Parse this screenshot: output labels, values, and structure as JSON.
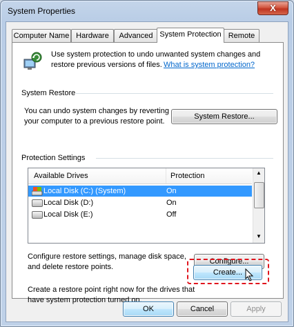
{
  "window": {
    "title": "System Properties",
    "close_glyph": "X"
  },
  "tabs": [
    {
      "label": "Computer Name"
    },
    {
      "label": "Hardware"
    },
    {
      "label": "Advanced"
    },
    {
      "label": "System Protection"
    },
    {
      "label": "Remote"
    }
  ],
  "intro": {
    "text_line1": "Use system protection to undo unwanted system changes and",
    "text_line2": "restore previous versions of files.",
    "link": "What is system protection?"
  },
  "system_restore": {
    "heading": "System Restore",
    "text_line1": "You can undo system changes by reverting",
    "text_line2": "your computer to a previous restore point.",
    "button": "System Restore..."
  },
  "protection": {
    "heading": "Protection Settings",
    "columns": [
      "Available Drives",
      "Protection"
    ],
    "rows": [
      {
        "drive": "Local Disk (C:) (System)",
        "protection": "On",
        "selected": true,
        "icon": "system-drive-icon"
      },
      {
        "drive": "Local Disk (D:)",
        "protection": "On",
        "selected": false,
        "icon": "drive-icon"
      },
      {
        "drive": "Local Disk (E:)",
        "protection": "Off",
        "selected": false,
        "icon": "drive-icon"
      }
    ],
    "configure_text_line1": "Configure restore settings, manage disk space,",
    "configure_text_line2": "and delete restore points.",
    "configure_button": "Configure...",
    "create_text_line1": "Create a restore point right now for the drives that",
    "create_text_line2": "have system protection turned on.",
    "create_button": "Create..."
  },
  "footer": {
    "ok": "OK",
    "cancel": "Cancel",
    "apply": "Apply"
  },
  "colors": {
    "highlight": "#e0141d",
    "selection": "#3399ff",
    "link": "#0066cc"
  }
}
